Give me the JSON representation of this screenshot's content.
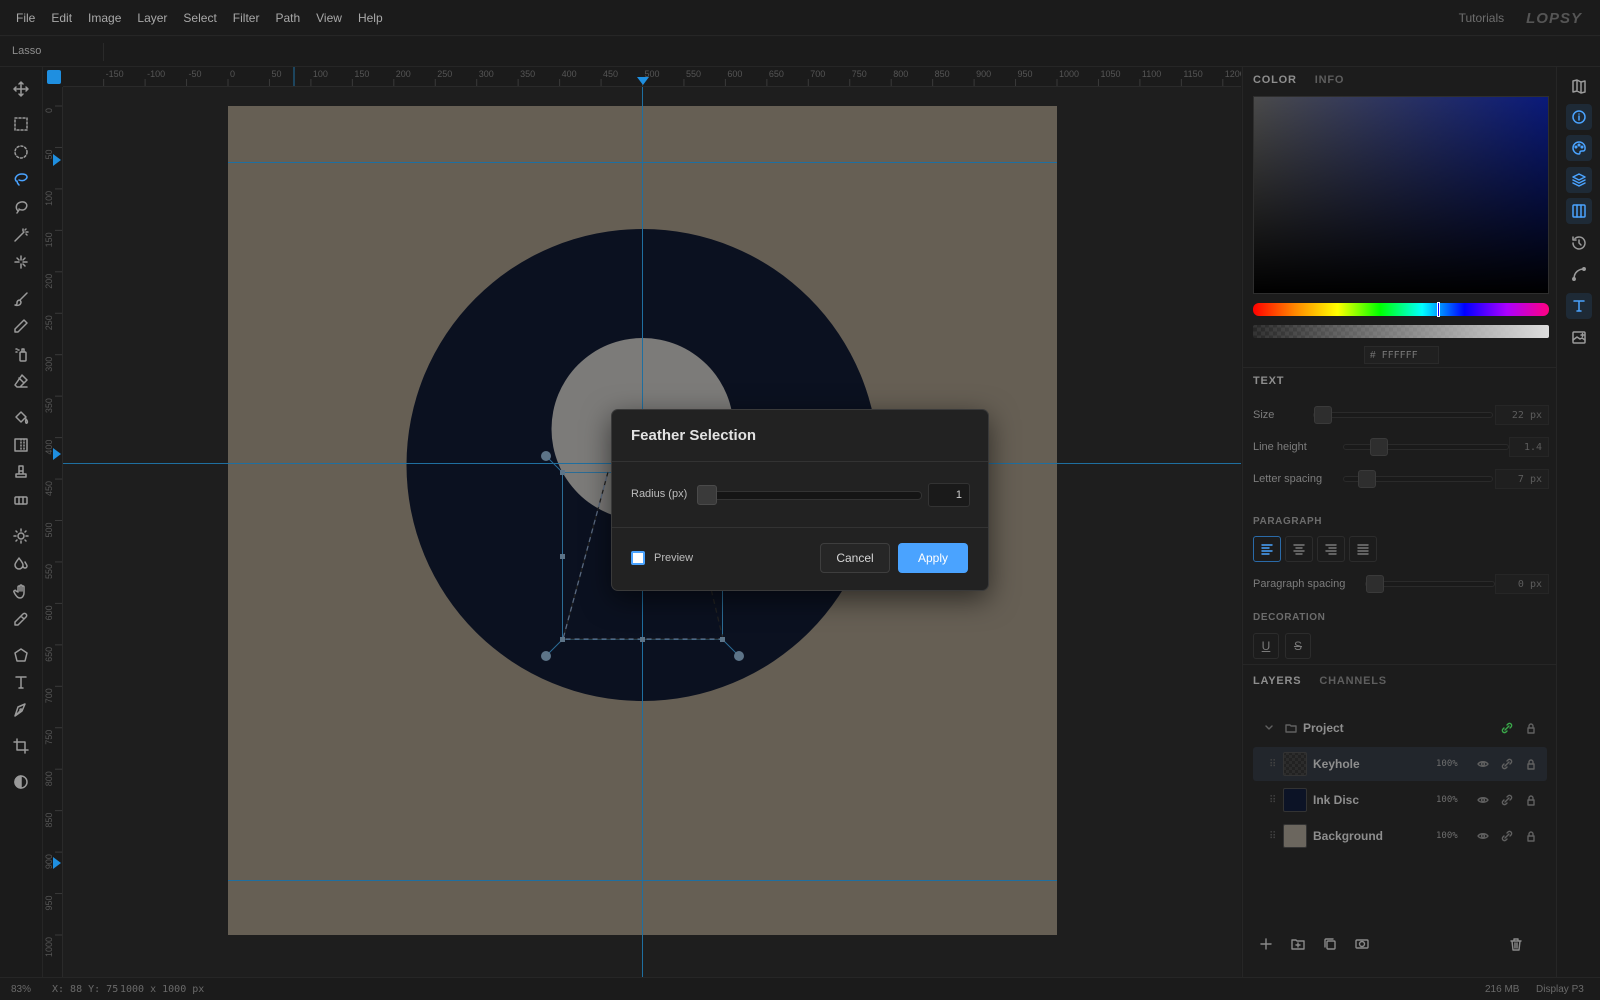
{
  "menubar": {
    "items": [
      "File",
      "Edit",
      "Image",
      "Layer",
      "Select",
      "Filter",
      "Path",
      "View",
      "Help"
    ],
    "tutorials": "Tutorials",
    "brand": "LOPSY"
  },
  "options_bar": {
    "tool_name": "Lasso"
  },
  "rulers": {
    "top_labels": [
      "-150",
      "-100",
      "-50",
      "0",
      "50",
      "100",
      "150",
      "200",
      "250",
      "300",
      "350",
      "400",
      "450",
      "500",
      "550",
      "600",
      "650",
      "700",
      "750",
      "800",
      "850",
      "900",
      "950",
      "1000",
      "1050",
      "1100",
      "1150",
      "1200"
    ],
    "left_labels": [
      "0",
      "50",
      "100",
      "150",
      "200",
      "250",
      "300",
      "350",
      "400",
      "450",
      "500",
      "550",
      "600",
      "650",
      "700",
      "750",
      "800",
      "850",
      "900",
      "950",
      "1000"
    ]
  },
  "canvas": {
    "background_color": "#665f54",
    "disc_color": "#0b1120",
    "keyhole_color": "#7e7e7e",
    "guide_color": "#1f6fa0"
  },
  "color_panel": {
    "tabs": [
      "COLOR",
      "INFO"
    ],
    "hex_prefix": "#",
    "hex_value": "FFFFFF"
  },
  "text_panel": {
    "title": "TEXT",
    "size_label": "Size",
    "size_value": "22 px",
    "line_height_label": "Line height",
    "line_height_value": "1.4",
    "letter_spacing_label": "Letter spacing",
    "letter_spacing_value": "7 px",
    "paragraph_head": "PARAGRAPH",
    "paragraph_spacing_label": "Paragraph spacing",
    "paragraph_spacing_value": "0 px",
    "decoration_head": "DECORATION",
    "underline": "U",
    "strike": "S"
  },
  "layers_panel": {
    "tabs": [
      "LAYERS",
      "CHANNELS"
    ],
    "group_name": "Project",
    "layers": [
      {
        "name": "Keyhole",
        "opacity": "100%",
        "selected": true
      },
      {
        "name": "Ink Disc",
        "opacity": "100%",
        "selected": false
      },
      {
        "name": "Background",
        "opacity": "100%",
        "selected": false
      }
    ]
  },
  "statusbar": {
    "zoom": "83%",
    "coords": "X: 88 Y: 75",
    "doc_size": "1000 x 1000 px",
    "memory": "216 MB",
    "display": "Display P3"
  },
  "dialog": {
    "title": "Feather Selection",
    "radius_label": "Radius (px)",
    "radius_value": "1",
    "preview_label": "Preview",
    "cancel_label": "Cancel",
    "apply_label": "Apply"
  },
  "colors": {
    "accent": "#4aa3ff",
    "panel_bg": "#1c1c1c"
  }
}
